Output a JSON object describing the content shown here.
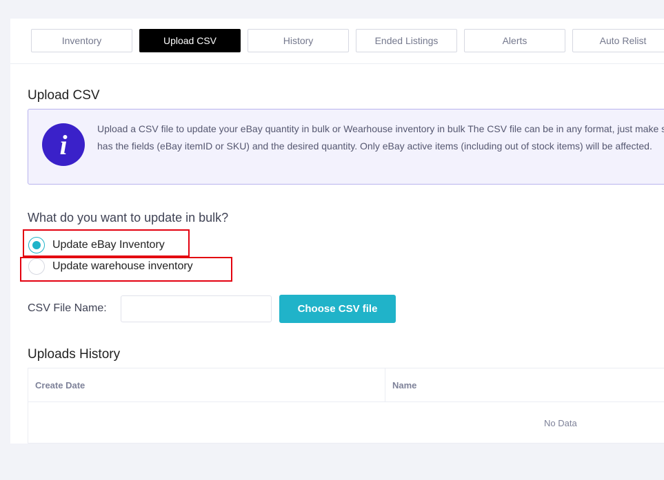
{
  "tabs": [
    {
      "label": "Inventory",
      "active": false
    },
    {
      "label": "Upload CSV",
      "active": true
    },
    {
      "label": "History",
      "active": false
    },
    {
      "label": "Ended Listings",
      "active": false
    },
    {
      "label": "Alerts",
      "active": false
    },
    {
      "label": "Auto Relist",
      "active": false
    }
  ],
  "upload": {
    "title": "Upload CSV",
    "info_icon": "info-icon",
    "info_line1": "Upload a CSV file to update your eBay quantity in bulk or Wearhouse inventory in bulk The CSV file can be in any format, just make sure it",
    "info_line2": "has the fields (eBay itemID or SKU) and the desired quantity. Only eBay active items (including out of stock items) will be affected."
  },
  "bulk": {
    "question": "What do you want to update in bulk?",
    "options": [
      {
        "label": "Update eBay Inventory",
        "checked": true
      },
      {
        "label": "Update warehouse inventory",
        "checked": false
      }
    ]
  },
  "file": {
    "label": "CSV File Name:",
    "value": "",
    "button": "Choose CSV file"
  },
  "history": {
    "title": "Uploads History",
    "columns": [
      "Create Date",
      "Name"
    ],
    "empty": "No Data"
  },
  "colors": {
    "accent": "#20b3c9",
    "info_icon_bg": "#3a21c9",
    "highlight": "#e3000f",
    "active_tab": "#000000"
  }
}
